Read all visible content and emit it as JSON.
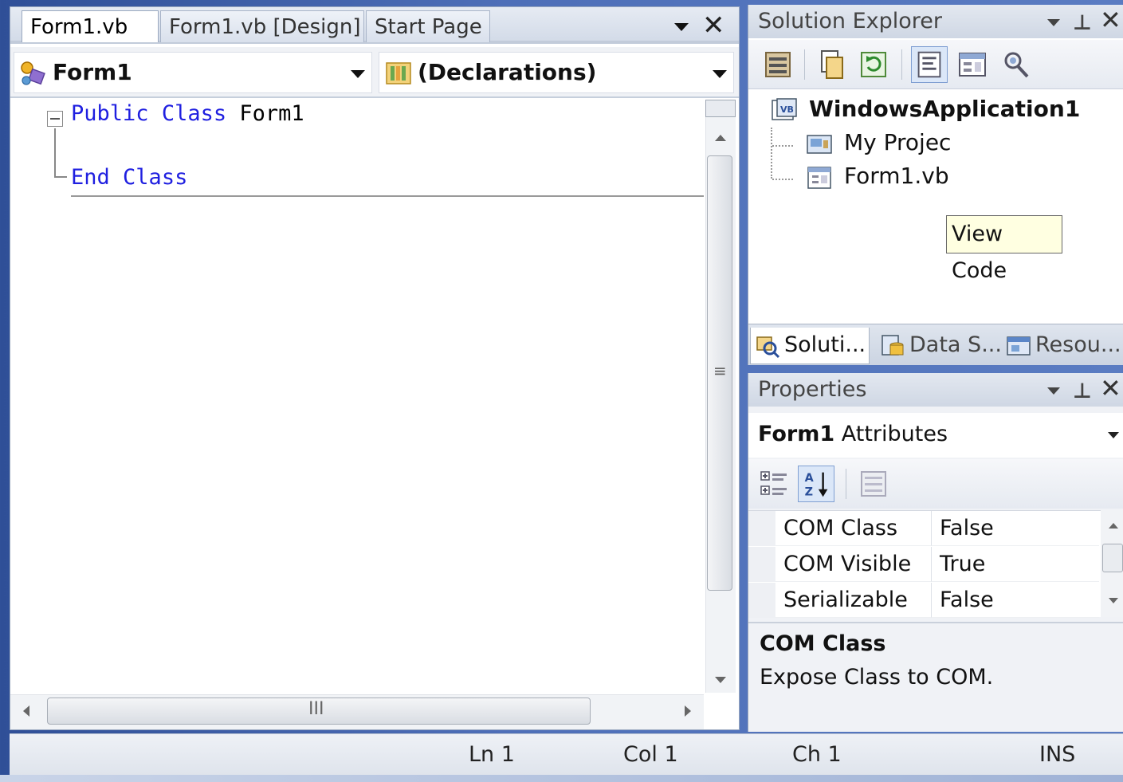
{
  "editor": {
    "tabs": [
      {
        "label": "Form1.vb",
        "active": true
      },
      {
        "label": "Form1.vb [Design]",
        "active": false
      },
      {
        "label": "Start Page",
        "active": false
      }
    ],
    "class_combo": {
      "value": "Form1",
      "icon": "class-icon"
    },
    "member_combo": {
      "value": "(Declarations)",
      "icon": "declarations-icon"
    },
    "code": {
      "line1": {
        "kw1": "Public",
        "kw2": "Class",
        "ident": "Form1"
      },
      "line2": {
        "kw1": "End",
        "kw2": "Class"
      }
    },
    "hscroll_grip": "III",
    "vscroll_grip": "≡"
  },
  "solution_explorer": {
    "title": "Solution Explorer",
    "toolbar_icons": [
      "properties-icon",
      "show-all-files-icon",
      "refresh-icon",
      "view-code-icon",
      "view-designer-icon",
      "class-view-icon"
    ],
    "tree": {
      "root": "WindowsApplication1",
      "items": [
        "My Projec",
        "Form1.vb"
      ]
    },
    "tooltip": "View Code",
    "bottom_tabs": [
      "Soluti...",
      "Data S...",
      "Resou..."
    ]
  },
  "properties": {
    "title": "Properties",
    "object_name": "Form1",
    "object_type": "Attributes",
    "rows": [
      {
        "name": "COM Class",
        "value": "False"
      },
      {
        "name": "COM Visible",
        "value": "True"
      },
      {
        "name": "Serializable",
        "value": "False"
      }
    ],
    "description_title": "COM Class",
    "description_text": "Expose Class to COM."
  },
  "status": {
    "ln": "Ln 1",
    "col": "Col 1",
    "ch": "Ch 1",
    "ins": "INS"
  },
  "colors": {
    "keyword": "#1f1fe0",
    "tooltip_bg": "#ffffe1",
    "desktop": "#4e6fb8"
  }
}
